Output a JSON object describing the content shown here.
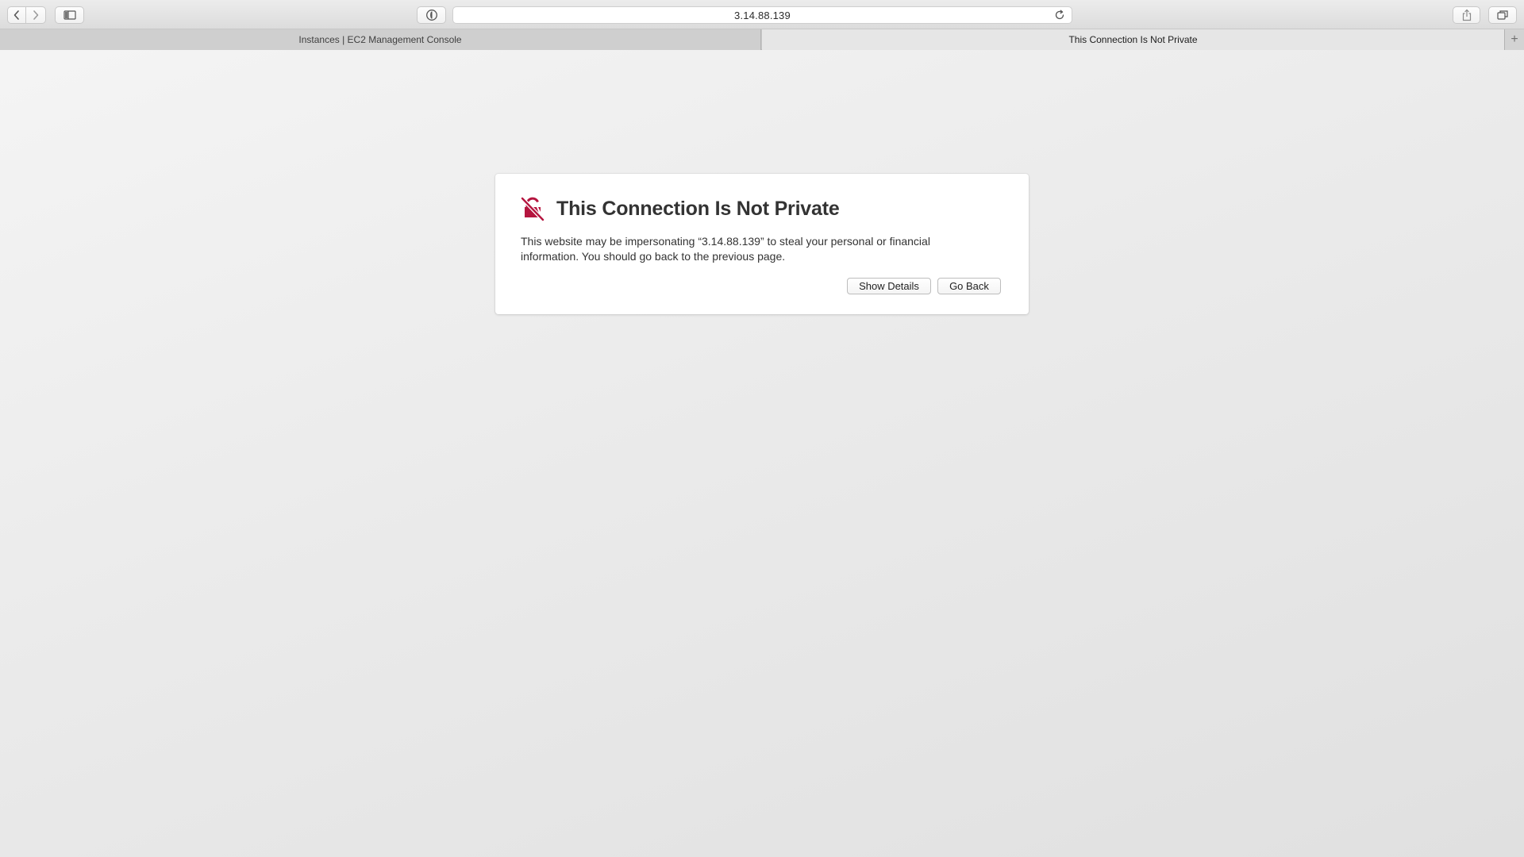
{
  "toolbar": {
    "back_icon": "chevron-left-icon",
    "forward_icon": "chevron-right-icon",
    "sidebar_icon": "sidebar-icon",
    "privacy_icon": "privacy-report-icon",
    "address": "3.14.88.139",
    "reload_icon": "reload-icon",
    "share_icon": "share-icon",
    "tabs_icon": "tab-overview-icon"
  },
  "tabs": [
    {
      "label": "Instances | EC2 Management Console",
      "active": false
    },
    {
      "label": "This Connection Is Not Private",
      "active": true
    }
  ],
  "new_tab_label": "+",
  "warning": {
    "icon": "broken-lock-icon",
    "title": "This Connection Is Not Private",
    "body_line1": "This website may be impersonating “3.14.88.139” to steal your personal or financial",
    "body_line2": "information. You should go back to the previous page.",
    "show_details_label": "Show Details",
    "go_back_label": "Go Back"
  },
  "colors": {
    "warning_icon": "#b5153f",
    "title_text": "#333333",
    "background": "#ebebeb"
  }
}
